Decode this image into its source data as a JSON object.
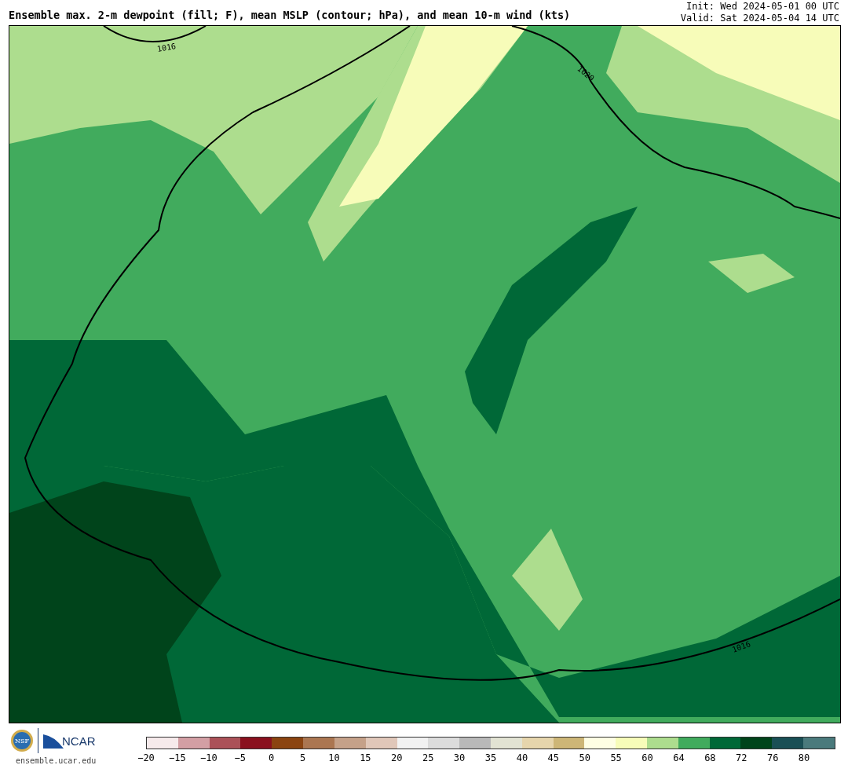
{
  "title": "Ensemble max. 2-m dewpoint (fill; F), mean MSLP (contour; hPa), and mean 10-m wind (kts)",
  "init": "Init: Wed 2024-05-01 00 UTC",
  "valid": "Valid: Sat 2024-05-04 14 UTC",
  "map": {
    "contour_labels": [
      "1016",
      "1020",
      "1016"
    ]
  },
  "logos": {
    "nsf": "NSF",
    "ncar": "NCAR",
    "site": "ensemble.ucar.edu"
  },
  "colorbar": {
    "segments": [
      {
        "color": "#f6eaeb"
      },
      {
        "color": "#d39fa4"
      },
      {
        "color": "#ab5158"
      },
      {
        "color": "#8a111e"
      },
      {
        "color": "#8b4411"
      },
      {
        "color": "#ab7651"
      },
      {
        "color": "#c5a189"
      },
      {
        "color": "#e0c7b9"
      },
      {
        "color": "#f2f2f2"
      },
      {
        "color": "#dcdcdc"
      },
      {
        "color": "#b9b9b9"
      },
      {
        "color": "#e2e3d3"
      },
      {
        "color": "#e6d5ac"
      },
      {
        "color": "#cdb677"
      },
      {
        "color": "#fefee4"
      },
      {
        "color": "#f7fcb9"
      },
      {
        "color": "#addd8e"
      },
      {
        "color": "#41ab5d"
      },
      {
        "color": "#006837"
      },
      {
        "color": "#00441b"
      },
      {
        "color": "#1a4f55"
      },
      {
        "color": "#4a7a7c"
      }
    ],
    "ticks": [
      "−20",
      "−15",
      "−10",
      "−5",
      "0",
      "5",
      "10",
      "15",
      "20",
      "25",
      "30",
      "35",
      "40",
      "45",
      "50",
      "55",
      "60",
      "64",
      "68",
      "72",
      "76",
      "80"
    ]
  }
}
